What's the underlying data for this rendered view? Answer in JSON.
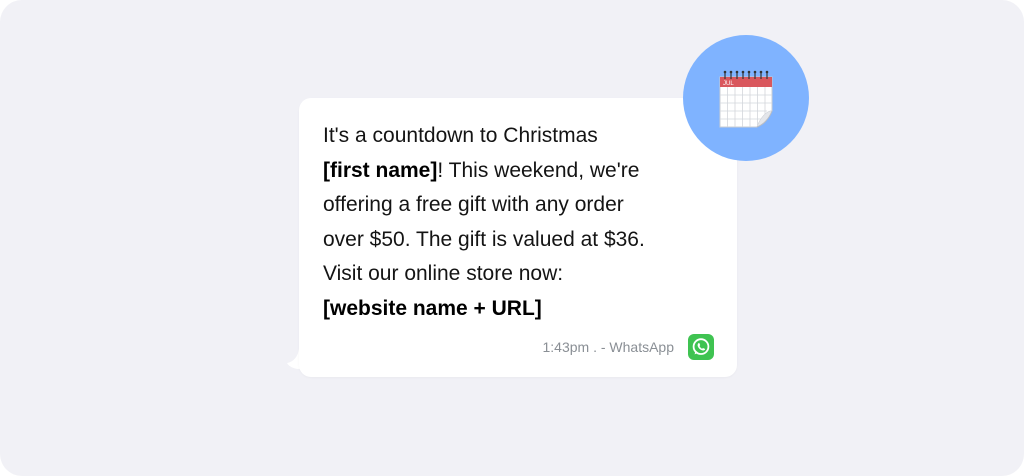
{
  "message": {
    "line1": "It's a countdown to Christmas",
    "first_name_placeholder": "[first name]",
    "line2_rest": "! This weekend, we're",
    "line3": "offering a free gift with any order",
    "line4": "over $50. The gift is valued at $36.",
    "line5": "Visit our online store now:",
    "website_placeholder": "[website name + URL]"
  },
  "meta": {
    "timestamp": "1:43pm . - WhatsApp"
  },
  "calendar": {
    "month_label": "JUL"
  },
  "icons": {
    "app": "whatsapp-icon",
    "avatar": "calendar-icon"
  },
  "colors": {
    "background": "#f1f1f6",
    "bubble": "#ffffff",
    "avatar_circle": "#7fb3ff",
    "whatsapp_green": "#3fc351",
    "calendar_header": "#d9575d"
  }
}
